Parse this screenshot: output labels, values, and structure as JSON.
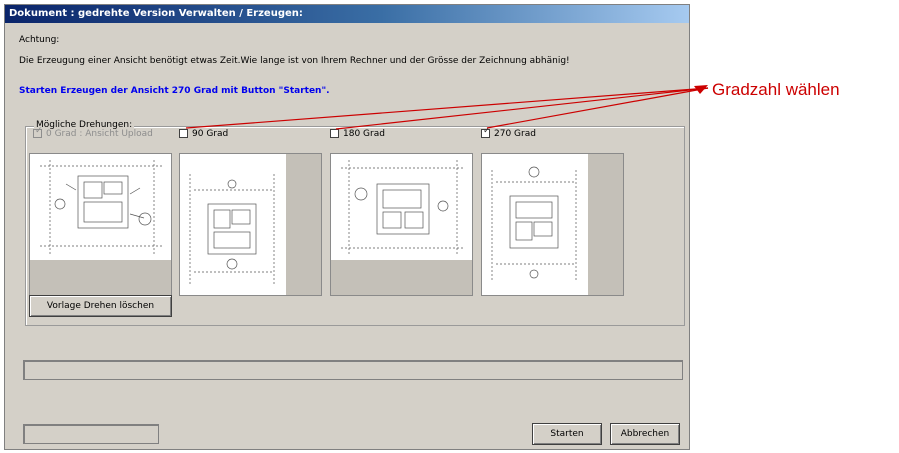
{
  "window": {
    "title": "Dokument : gedrehte Version Verwalten / Erzeugen:"
  },
  "notice": {
    "heading": "Achtung:",
    "text": "Die Erzeugung einer Ansicht benötigt etwas Zeit.Wie lange ist von Ihrem Rechner und der Grösse der Zeichnung abhänig!",
    "info": "Starten Erzeugen der Ansicht 270 Grad mit Button \"Starten\"."
  },
  "rotations": {
    "legend": "Mögliche Drehungen:",
    "options": [
      {
        "label": "0 Grad : Ansicht Upload",
        "checked": true,
        "disabled": true
      },
      {
        "label": "90 Grad",
        "checked": false,
        "disabled": false
      },
      {
        "label": "180 Grad",
        "checked": false,
        "disabled": false
      },
      {
        "label": "270 Grad",
        "checked": true,
        "disabled": false
      }
    ]
  },
  "buttons": {
    "delete_label": "Vorlage Drehen löschen",
    "start_label": "Starten",
    "cancel_label": "Abbrechen"
  },
  "annotation": {
    "text": "Gradzahl wählen",
    "color": "#cc0000"
  }
}
